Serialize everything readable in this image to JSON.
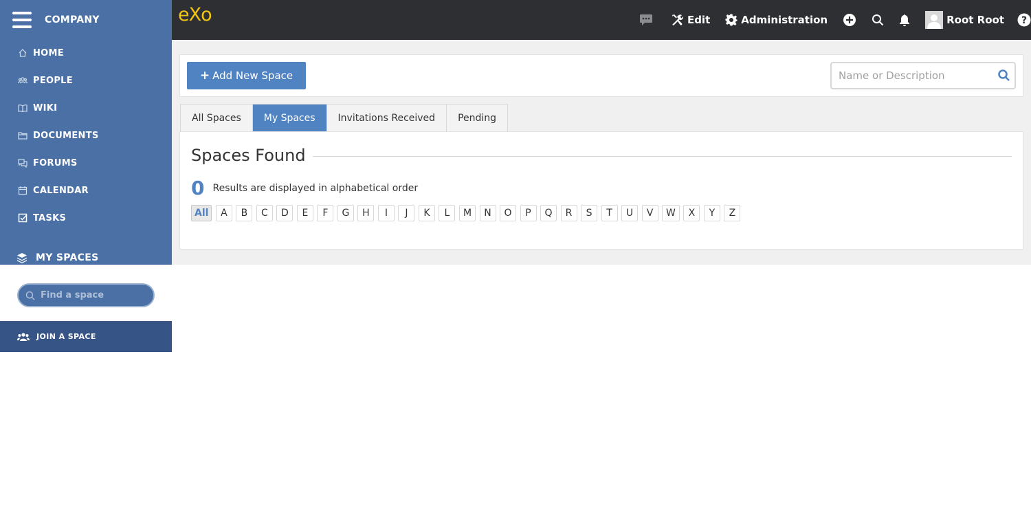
{
  "sidebar": {
    "company": "COMPANY",
    "items": [
      {
        "label": "HOME",
        "icon": "home-icon"
      },
      {
        "label": "PEOPLE",
        "icon": "people-icon"
      },
      {
        "label": "WIKI",
        "icon": "book-icon"
      },
      {
        "label": "DOCUMENTS",
        "icon": "folder-icon"
      },
      {
        "label": "FORUMS",
        "icon": "forum-icon"
      },
      {
        "label": "CALENDAR",
        "icon": "calendar-icon"
      },
      {
        "label": "TASKS",
        "icon": "tasks-icon"
      }
    ],
    "my_spaces_label": "MY SPACES",
    "find_space_placeholder": "Find a space",
    "join_space_label": "JOIN A SPACE"
  },
  "topbar": {
    "logo_text_e": "e",
    "logo_text_x": "X",
    "logo_text_o": "o",
    "edit_label": "Edit",
    "admin_label": "Administration",
    "user_name": "Root Root"
  },
  "main": {
    "add_space_label": "Add New Space",
    "search_placeholder": "Name or Description",
    "tabs": [
      {
        "label": "All Spaces",
        "active": false
      },
      {
        "label": "My Spaces",
        "active": true
      },
      {
        "label": "Invitations Received",
        "active": false
      },
      {
        "label": "Pending",
        "active": false
      }
    ],
    "title": "Spaces Found",
    "result_count": "0",
    "result_text": "Results are displayed in alphabetical order",
    "letters": [
      "All",
      "A",
      "B",
      "C",
      "D",
      "E",
      "F",
      "G",
      "H",
      "I",
      "J",
      "K",
      "L",
      "M",
      "N",
      "O",
      "P",
      "Q",
      "R",
      "S",
      "T",
      "U",
      "V",
      "W",
      "X",
      "Y",
      "Z"
    ],
    "active_letter": "All"
  },
  "colors": {
    "sidebar_bg": "#4a70a5",
    "topbar_bg": "#2d2f33",
    "accent": "#5083c2",
    "logo": "#f4c414",
    "join_bg": "#365586"
  }
}
